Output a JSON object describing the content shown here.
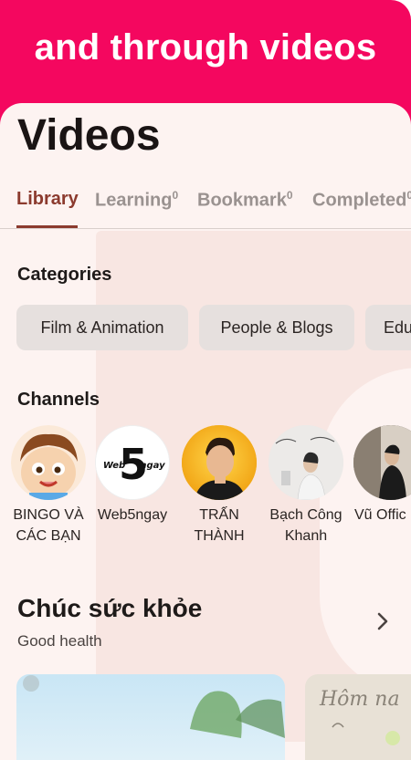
{
  "promo": {
    "text": "and through videos",
    "background": "#f4075f"
  },
  "page": {
    "title": "Videos"
  },
  "tabs": [
    {
      "label": "Library",
      "count": "",
      "active": true
    },
    {
      "label": "Learning",
      "count": "0",
      "active": false
    },
    {
      "label": "Bookmark",
      "count": "0",
      "active": false
    },
    {
      "label": "Completed",
      "count": "0",
      "active": false
    }
  ],
  "categories": {
    "title": "Categories",
    "items": [
      "Film & Animation",
      "People & Blogs",
      "Edu"
    ]
  },
  "channels": {
    "title": "Channels",
    "items": [
      {
        "name": "BINGO VÀ CÁC BẠN"
      },
      {
        "name": "Web5ngay",
        "logo_text": "Web 5 ngay"
      },
      {
        "name": "TRẤN THÀNH"
      },
      {
        "name": "Bạch Công Khanh"
      },
      {
        "name": "Vũ Offic"
      }
    ]
  },
  "health": {
    "title": "Chúc sức khỏe",
    "subtitle": "Good health",
    "more_icon": "chevron-right-icon"
  },
  "thumbnails": [
    {
      "label": ""
    },
    {
      "label": "Hôm na"
    }
  ],
  "colors": {
    "accent": "#8b3a2e",
    "surface": "#fdf3f1",
    "chip": "#e6e0de"
  }
}
